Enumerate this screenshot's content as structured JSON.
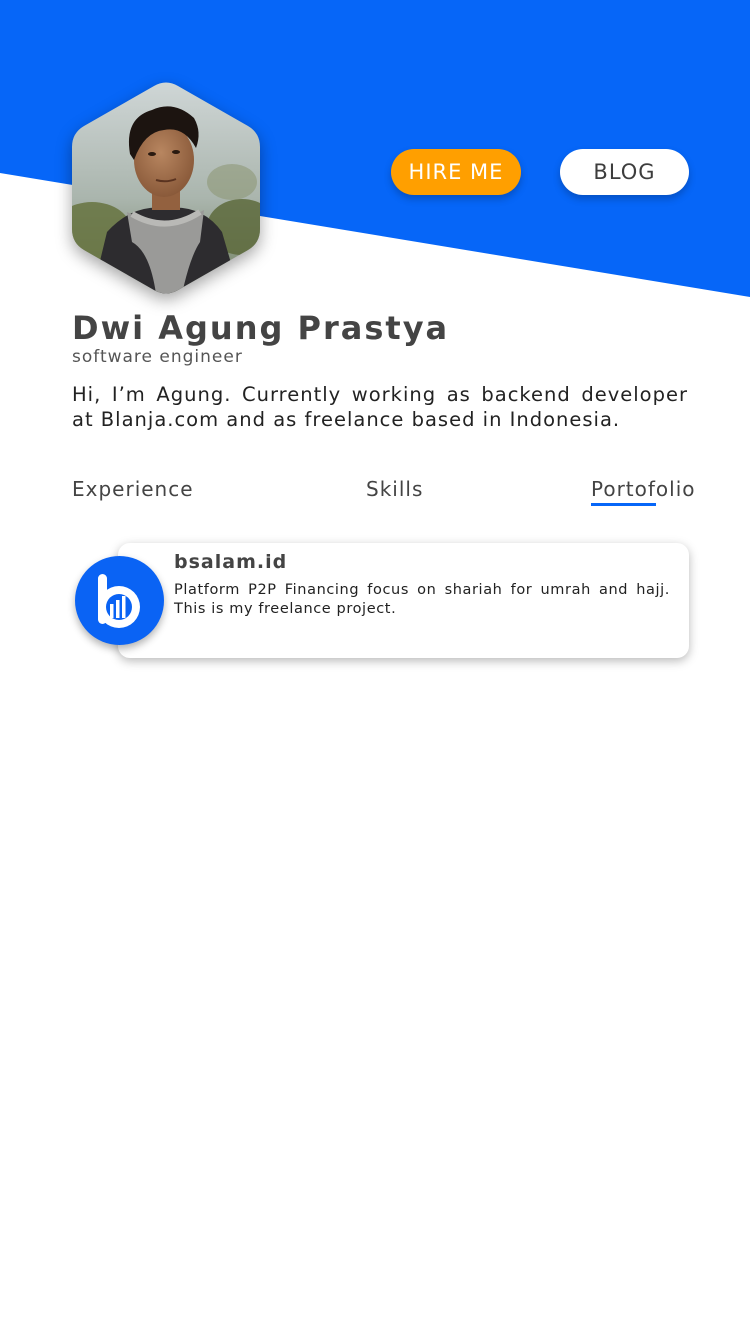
{
  "colors": {
    "header_blue": "#0666f8",
    "hire_orange": "#ff9f00",
    "logo_blue": "#0a63f4",
    "tab_underline": "#0666f8"
  },
  "header": {
    "hire_label": "HIRE ME",
    "blog_label": "BLOG"
  },
  "profile": {
    "name": "Dwi Agung Prastya",
    "role": "software engineer",
    "bio": "Hi, I’m Agung. Currently working as backend developer at Blanja.com and as freelance based in Indonesia."
  },
  "tabs": [
    {
      "label": "Experience",
      "active": false
    },
    {
      "label": "Skills",
      "active": false
    },
    {
      "label": "Portofolio",
      "active": true
    }
  ],
  "portfolio": [
    {
      "title": "bsalam.id",
      "description": "Platform P2P Financing focus on shariah for umrah and hajj. This is my freelance project.",
      "logo_icon": "bsalam-logo-icon"
    }
  ]
}
